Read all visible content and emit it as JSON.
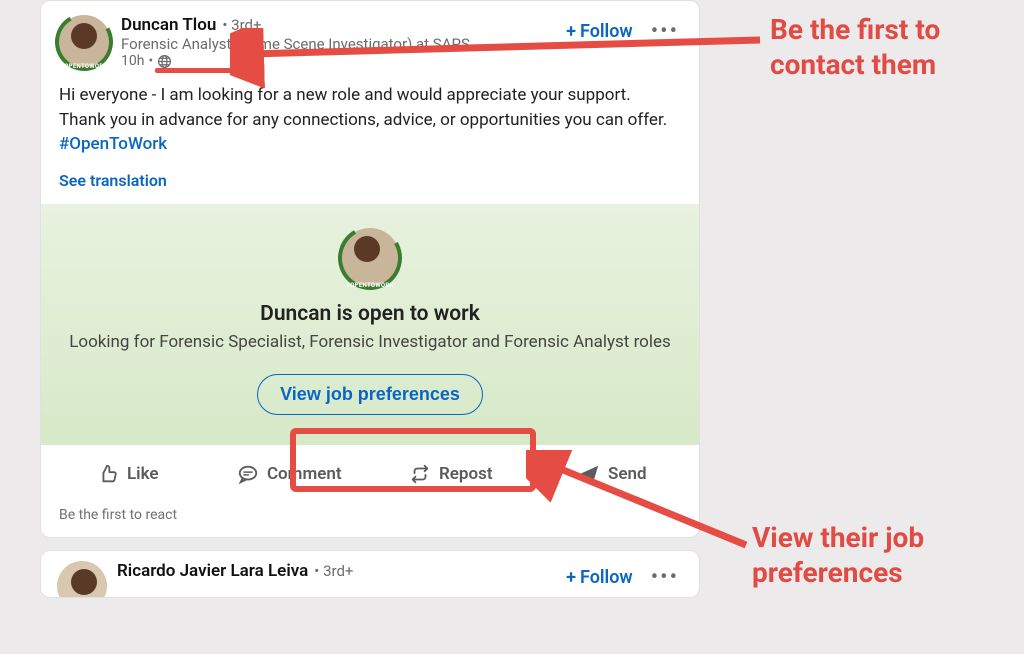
{
  "post1": {
    "author": "Duncan Tlou",
    "degree": "3rd+",
    "subtitle": "Forensic Analyst (Crime Scene Investigator) at SAPS, …",
    "time": "10h",
    "follow_label": "Follow",
    "body_text": "Hi everyone - I am looking for a new role and would appreciate your support. Thank you in advance for any connections, advice, or opportunities you can offer. ",
    "hashtag": "#OpenToWork",
    "see_translation": "See translation",
    "otw_title": "Duncan is open to work",
    "otw_subtitle": "Looking for Forensic Specialist, Forensic Investigator and Forensic Analyst roles",
    "prefs_button": "View job preferences",
    "actions": {
      "like": "Like",
      "comment": "Comment",
      "repost": "Repost",
      "send": "Send"
    },
    "react_prompt": "Be the first to react"
  },
  "post2": {
    "author": "Ricardo Javier Lara Leiva",
    "degree": "3rd+",
    "follow_label": "Follow"
  },
  "annotations": {
    "callout1": "Be the first to contact them",
    "callout2": "View their job preferences"
  }
}
